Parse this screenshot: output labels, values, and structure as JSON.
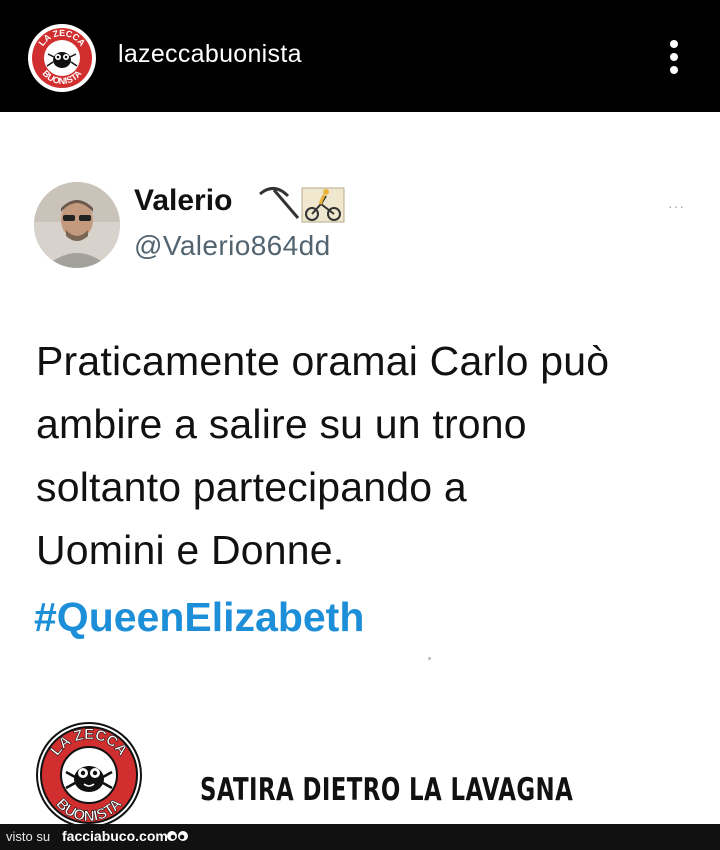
{
  "header": {
    "username": "lazeccabuonista",
    "logo_text_top": "LA ZECCA",
    "logo_text_bottom": "BUONISTA",
    "menu_icon": "kebab-menu-icon"
  },
  "tweet": {
    "author_name": "Valerio",
    "author_handle": "@Valerio864dd",
    "emojis": [
      "hammer-pick-icon",
      "cyclist-icon"
    ],
    "text": "Praticamente oramai Carlo può\nambire a salire su un trono\nsoltanto partecipando a\nUomini e Donne.",
    "hashtag": "#QueenElizabeth",
    "more_icon": "more-dots-icon",
    "more_label": "···"
  },
  "footer": {
    "tagline": "SATIRA DIETRO LA LAVAGNA",
    "logo_text_top": "LA ZECCA",
    "logo_text_bottom": "BUONISTA"
  },
  "watermark": {
    "prefix": "visto su",
    "site": "facciabuco.com"
  },
  "colors": {
    "header_bg": "#000000",
    "hashtag": "#1d8fd8",
    "handle": "#536471",
    "logo_red": "#d12f2f"
  }
}
